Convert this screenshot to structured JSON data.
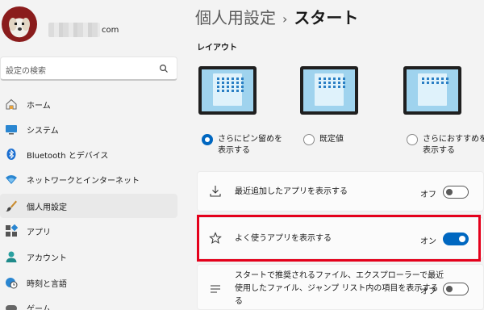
{
  "profile": {
    "email_suffix": "com"
  },
  "search": {
    "placeholder": "設定の検索"
  },
  "sidebar": {
    "items": [
      {
        "label": "ホーム",
        "icon": "home-icon"
      },
      {
        "label": "システム",
        "icon": "system-icon"
      },
      {
        "label": "Bluetooth とデバイス",
        "icon": "bluetooth-icon"
      },
      {
        "label": "ネットワークとインターネット",
        "icon": "network-icon"
      },
      {
        "label": "個人用設定",
        "icon": "brush-icon",
        "active": true
      },
      {
        "label": "アプリ",
        "icon": "apps-icon"
      },
      {
        "label": "アカウント",
        "icon": "account-icon"
      },
      {
        "label": "時刻と言語",
        "icon": "globe-clock-icon"
      },
      {
        "label": "ゲーム",
        "icon": "game-icon"
      }
    ]
  },
  "header": {
    "breadcrumb": "個人用設定",
    "separator": "›",
    "title": "スタート"
  },
  "layout": {
    "heading": "レイアウト",
    "options": [
      {
        "line1": "さらにピン留めを",
        "line2": "表示する",
        "selected": true
      },
      {
        "line1": "既定値",
        "line2": "",
        "selected": false
      },
      {
        "line1": "さらにおすすめを",
        "line2": "表示する",
        "selected": false
      }
    ]
  },
  "settings": [
    {
      "label": "最近追加したアプリを表示する",
      "state": "オフ",
      "on": false,
      "icon": "download-icon"
    },
    {
      "label": "よく使うアプリを表示する",
      "state": "オン",
      "on": true,
      "icon": "star-icon"
    },
    {
      "label_line1": "スタートで推奨されるファイル、エクスプローラーで最近",
      "label_line2": "使用したファイル、ジャンプ リスト内の項目を表示する",
      "label_line3": "る",
      "state": "オフ",
      "on": false,
      "icon": "list-icon"
    }
  ],
  "colors": {
    "accent": "#0067c0",
    "highlight": "#e4001b"
  }
}
